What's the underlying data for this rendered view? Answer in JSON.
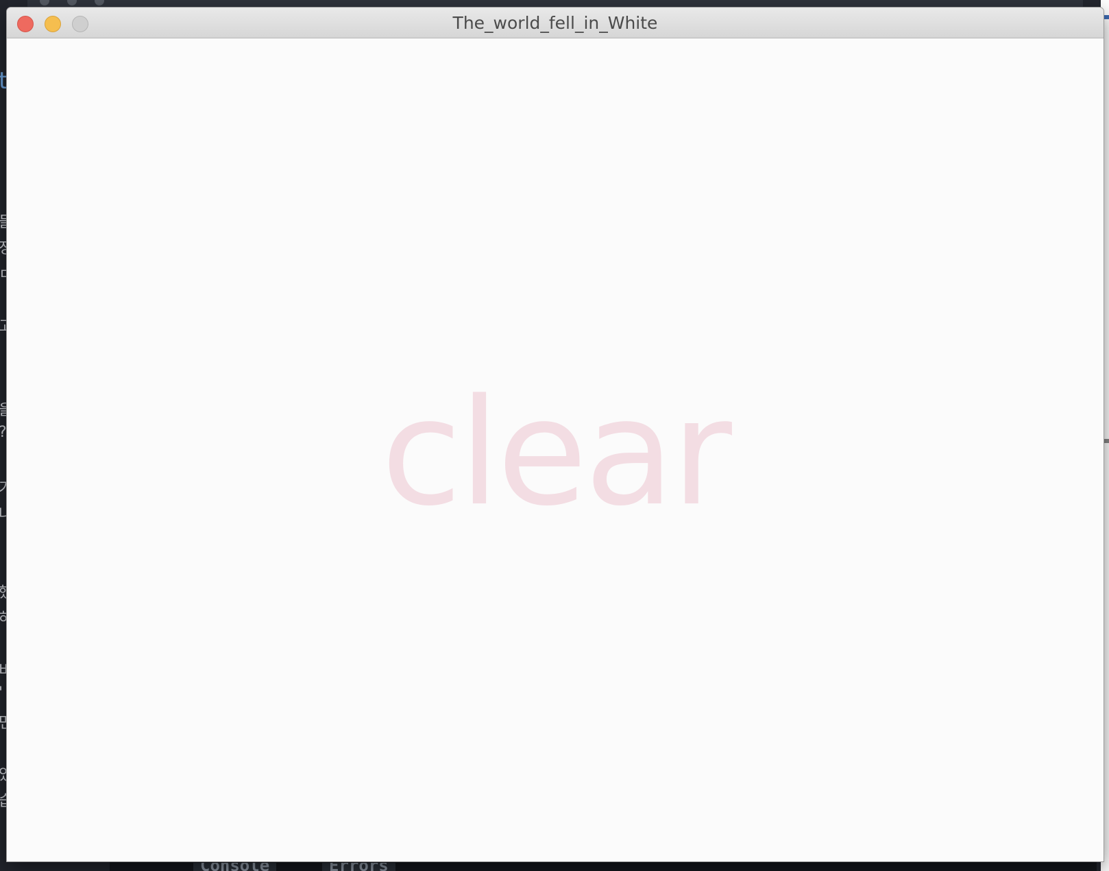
{
  "window": {
    "title": "The_world_fell_in_White"
  },
  "game": {
    "message": "clear",
    "message_color": "#f3dde3",
    "background_color": "#fbfbfb"
  },
  "background_ide": {
    "tabs": [
      "Console",
      "Errors"
    ],
    "left_fragments": [
      "t",
      "들",
      "정",
      "ㅁ",
      "고",
      "을",
      "?",
      "기",
      "나",
      "했",
      "하",
      "비",
      "'",
      "면",
      "었",
      "습"
    ]
  },
  "colors": {
    "close": "#ee6a5f",
    "minimize": "#f5be4f",
    "maximize": "#cfcfcf"
  }
}
